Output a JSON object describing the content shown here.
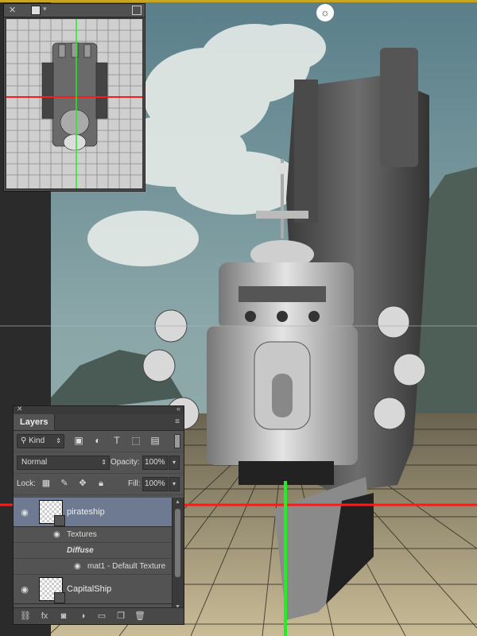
{
  "colors": {
    "accent_red": "#ff1a1a",
    "accent_green": "#22ee22",
    "selection": "#6d7a91"
  },
  "axes_panel": {
    "icons": [
      "close-icon",
      "panel-menu-icon",
      "resize-icon"
    ]
  },
  "gizmo": {
    "icon": "sun-icon"
  },
  "layers_panel": {
    "tab_label": "Layers",
    "filter": {
      "kind_label": "Kind"
    },
    "blend_mode": "Normal",
    "opacity_label": "Opacity:",
    "opacity_value": "100%",
    "lock_label": "Lock:",
    "fill_label": "Fill:",
    "fill_value": "100%",
    "layers": [
      {
        "name": "pirateship",
        "selected": true
      },
      {
        "name": "CapitalShip",
        "selected": false
      }
    ],
    "sublayers": {
      "textures_label": "Textures",
      "diffuse_label": "Diffuse",
      "material_label": "mat1 - Default Texture"
    },
    "bottom_icons": [
      "link-icon",
      "fx-icon",
      "mask-icon",
      "adjustment-icon",
      "folder-icon",
      "new-layer-icon",
      "trash-icon"
    ]
  }
}
